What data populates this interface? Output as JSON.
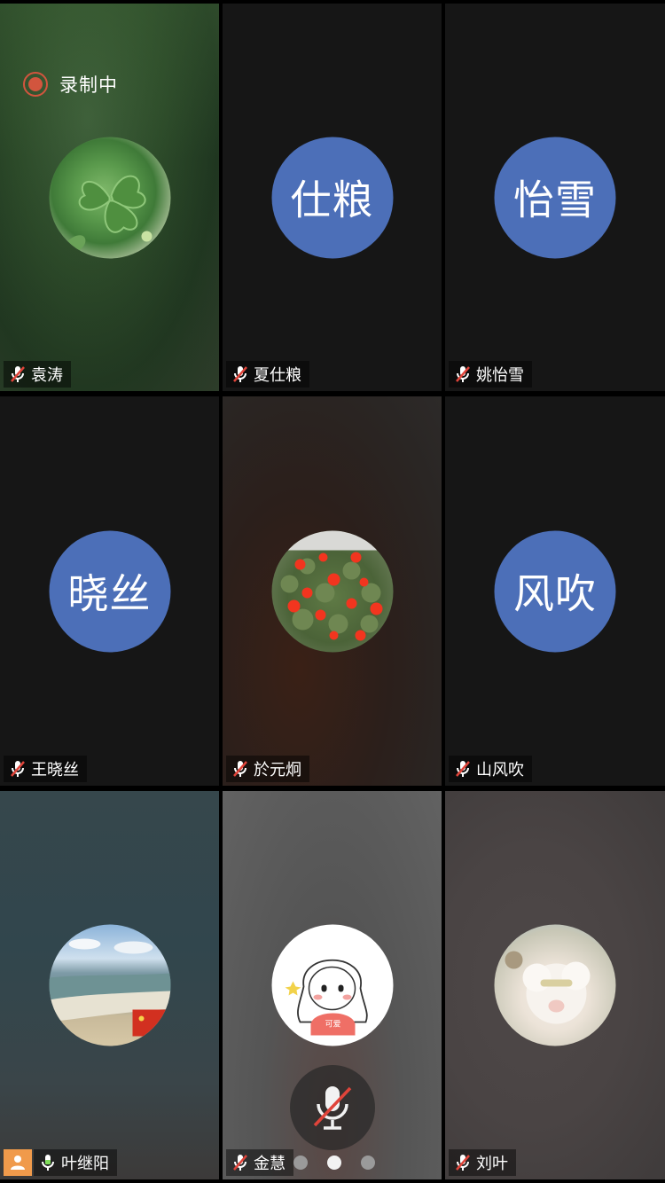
{
  "recording": {
    "label": "录制中",
    "color": "#d2553e"
  },
  "participants": [
    {
      "name": "袁涛",
      "avatar_text": "",
      "avatar_image": "four-leaf-clover photo",
      "mic": "muted"
    },
    {
      "name": "夏仕粮",
      "avatar_text": "仕粮",
      "mic": "muted"
    },
    {
      "name": "姚怡雪",
      "avatar_text": "怡雪",
      "mic": "muted"
    },
    {
      "name": "王晓丝",
      "avatar_text": "晓丝",
      "mic": "muted"
    },
    {
      "name": "於元炯",
      "avatar_text": "",
      "avatar_image": "red cactus flowers photo",
      "mic": "muted"
    },
    {
      "name": "山风吹",
      "avatar_text": "风吹",
      "mic": "muted"
    },
    {
      "name": "叶继阳",
      "avatar_text": "",
      "avatar_image": "beach photo",
      "mic": "on",
      "host": true
    },
    {
      "name": "金慧",
      "avatar_text": "",
      "avatar_image": "cartoon girl illustration",
      "mic": "muted"
    },
    {
      "name": "刘叶",
      "avatar_text": "",
      "avatar_image": "white plush lamb photo",
      "mic": "muted"
    }
  ],
  "girl_shirt_text": "可爱",
  "colors": {
    "avatar_blue": "#4c6fb8",
    "host_badge": "#f09a4b",
    "mic_on": "#7fdc5a",
    "mute_slash": "#e0443a"
  },
  "pager": {
    "pages": 3,
    "current": 2
  },
  "mic_button": {
    "state": "muted"
  }
}
